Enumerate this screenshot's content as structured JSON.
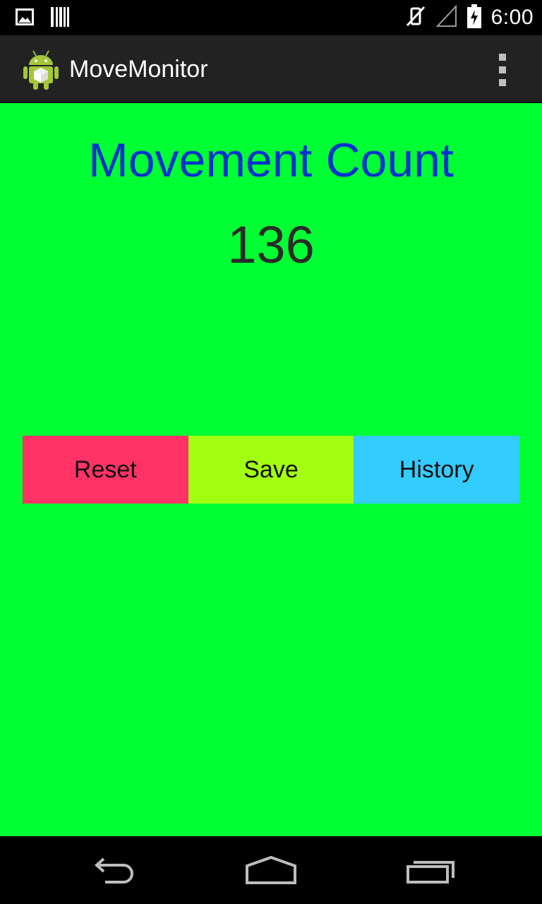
{
  "status_bar": {
    "time": "6:00",
    "icons": [
      "gallery-notification-icon",
      "barcode-notification-icon",
      "vibrate-off-icon",
      "signal-icon",
      "battery-charging-icon"
    ]
  },
  "action_bar": {
    "title": "MoveMonitor",
    "app_icon": "android-robot-icon",
    "overflow_icon": "overflow-menu-icon"
  },
  "main": {
    "heading": "Movement Count",
    "count": "136",
    "buttons": [
      {
        "label": "Reset",
        "color": "#ff3366"
      },
      {
        "label": "Save",
        "color": "#a3ff11"
      },
      {
        "label": "History",
        "color": "#33ccff"
      }
    ]
  },
  "nav_bar": {
    "icons": [
      "back-icon",
      "home-icon",
      "recent-apps-icon"
    ]
  },
  "colors": {
    "background": "#00ff33",
    "heading": "#0033cc",
    "action_bar": "#222222"
  }
}
